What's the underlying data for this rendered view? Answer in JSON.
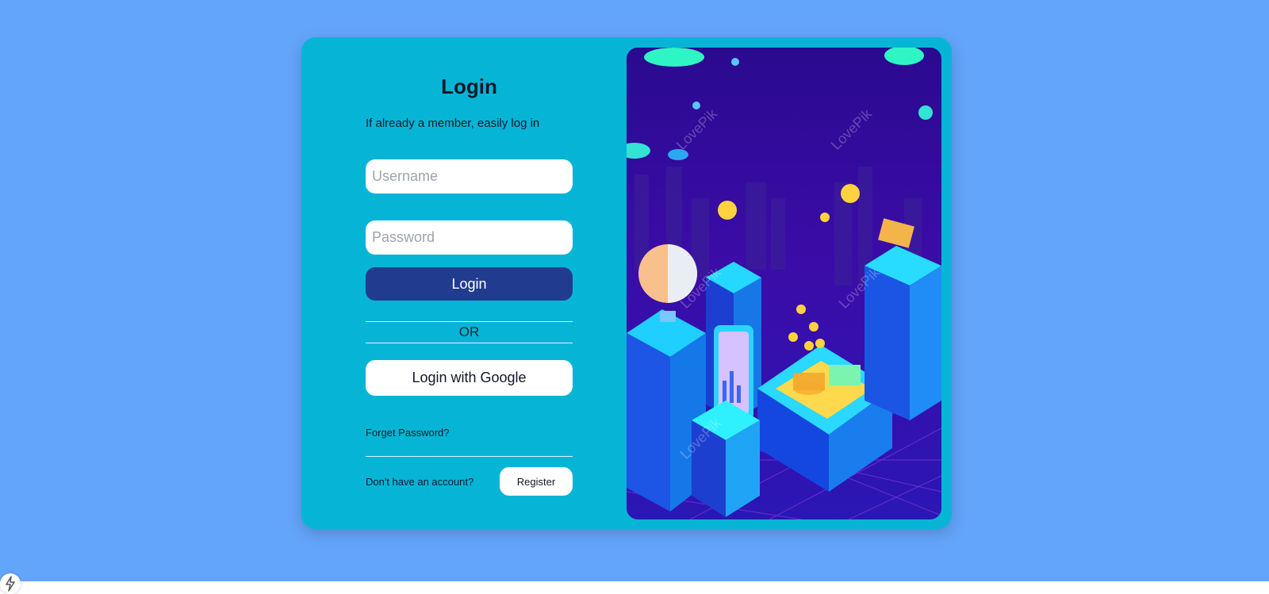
{
  "login": {
    "title": "Login",
    "subtitle": "If already a member, easily log in",
    "username_placeholder": "Username",
    "password_placeholder": "Password",
    "login_button": "Login",
    "or_text": "OR",
    "google_button": "Login with Google",
    "forget_password": "Forget Password?",
    "no_account_text": "Don't have an account?",
    "register_button": "Register"
  },
  "illustration": {
    "watermark": "LovePik"
  },
  "icons": {
    "corner_badge": "lightning-icon"
  },
  "colors": {
    "page_background": "#63a5fb",
    "card_background": "#06b5d6",
    "login_button": "#213c8f",
    "illustration_background": "#2a0a8f"
  }
}
